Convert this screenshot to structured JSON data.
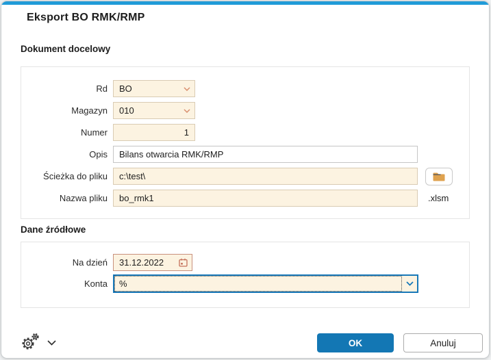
{
  "dialog": {
    "title": "Eksport BO RMK/RMP"
  },
  "colors": {
    "accent_bar": "#209bd8",
    "primary_button": "#1377b4",
    "field_background": "#fcf3e1",
    "field_border": "#d9cbb3",
    "date_field_border": "#c9907c",
    "combo_focus_border": "#1778b8",
    "dropdown_chevron": "#d98f6f",
    "folder_icon": "#dfa24f"
  },
  "sections": {
    "target": {
      "label": "Dokument docelowy",
      "fields": {
        "rd": {
          "label": "Rd",
          "value": "BO"
        },
        "magazyn": {
          "label": "Magazyn",
          "value": "010"
        },
        "numer": {
          "label": "Numer",
          "value": "1"
        },
        "opis": {
          "label": "Opis",
          "value": "Bilans otwarcia RMK/RMP"
        },
        "sciezka": {
          "label": "Ścieżka do pliku",
          "value": "c:\\test\\"
        },
        "nazwa": {
          "label": "Nazwa pliku",
          "value": "bo_rmk1",
          "suffix": ".xlsm"
        }
      }
    },
    "source": {
      "label": "Dane źródłowe",
      "fields": {
        "na_dzien": {
          "label": "Na dzień",
          "value": "31.12.2022"
        },
        "konta": {
          "label": "Konta",
          "value": "%"
        }
      }
    }
  },
  "footer": {
    "ok_label": "OK",
    "cancel_label": "Anuluj"
  },
  "icons": {
    "settings": "settings-gears-icon",
    "settings_expand": "chevron-down-icon",
    "rd_dropdown": "chevron-down-icon",
    "magazyn_dropdown": "chevron-down-icon",
    "browse": "folder-icon",
    "date": "calendar-icon",
    "konta_dropdown": "chevron-down-icon"
  }
}
